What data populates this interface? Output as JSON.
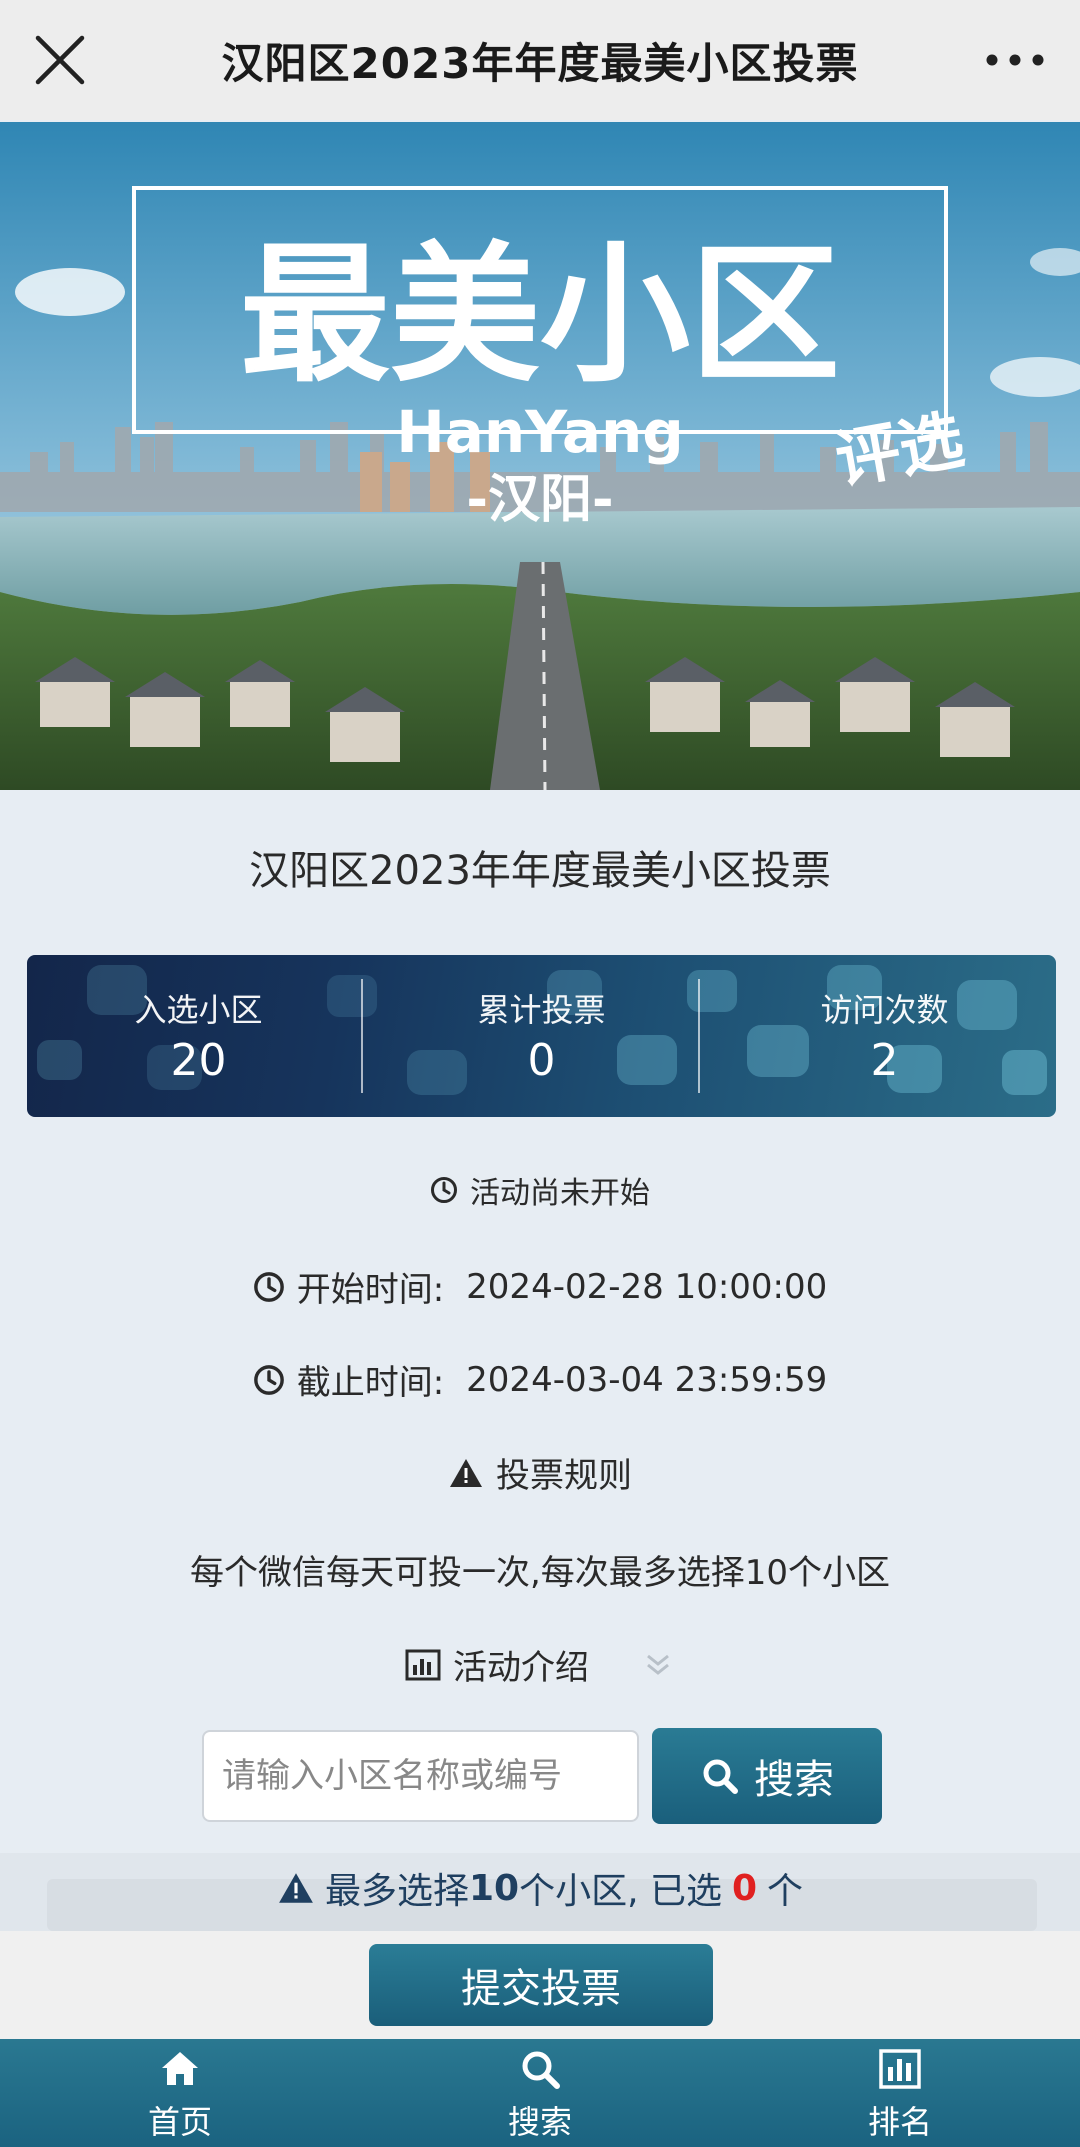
{
  "topbar": {
    "title": "汉阳区2023年年度最美小区投票"
  },
  "banner": {
    "headline": "最美小区",
    "subtitle_en": "HanYang",
    "subtitle_cn": "-汉阳-",
    "stamp": "评选"
  },
  "event_title": "汉阳区2023年年度最美小区投票",
  "stats": [
    {
      "label": "入选小区",
      "value": "20"
    },
    {
      "label": "累计投票",
      "value": "0"
    },
    {
      "label": "访问次数",
      "value": "2"
    }
  ],
  "status": "活动尚未开始",
  "start": {
    "label": "开始时间:",
    "value": "2024-02-28 10:00:00"
  },
  "end": {
    "label": "截止时间:",
    "value": "2024-03-04 23:59:59"
  },
  "rules": {
    "heading": "投票规则",
    "text": "每个微信每天可投一次,每次最多选择10个小区"
  },
  "intro": {
    "label": "活动介绍"
  },
  "search": {
    "placeholder": "请输入小区名称或编号",
    "button": "搜索"
  },
  "selection_notice": {
    "prefix": "最多选择",
    "max": "10",
    "middle": "个小区, 已选",
    "count": "0",
    "suffix": "个"
  },
  "submit_label": "提交投票",
  "tabbar": [
    {
      "label": "首页",
      "icon": "home-icon"
    },
    {
      "label": "搜索",
      "icon": "search-icon"
    },
    {
      "label": "排名",
      "icon": "chart-icon"
    }
  ],
  "colors": {
    "accent": "#1e6a86",
    "alert": "#e02020"
  }
}
